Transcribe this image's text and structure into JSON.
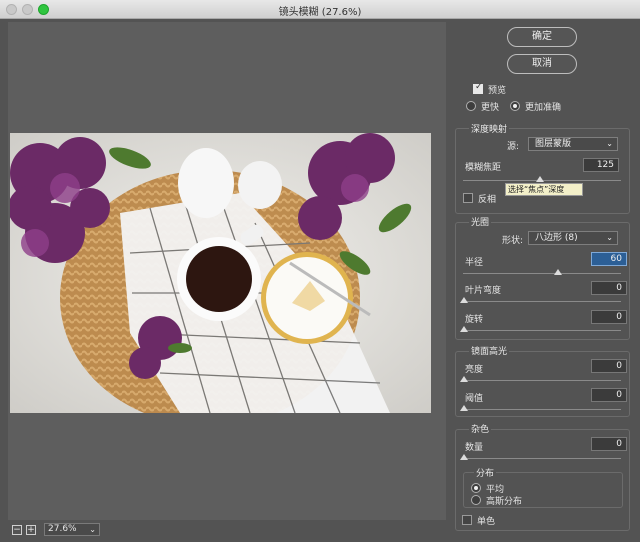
{
  "window": {
    "title": "镜头模糊 (27.6%)"
  },
  "buttons": {
    "ok": "确定",
    "cancel": "取消"
  },
  "preview": {
    "checkbox_label": "预览",
    "radio_faster": "更快",
    "radio_accurate": "更加准确"
  },
  "depth_map": {
    "title": "深度映射",
    "source_label": "源:",
    "source_value": "图层蒙版",
    "blur_focal_label": "模糊焦距",
    "blur_focal_value": "125",
    "blur_focal_level": 125,
    "invert_label": "反相",
    "tooltip": "选择“焦点”深度"
  },
  "iris": {
    "title": "光圈",
    "shape_label": "形状:",
    "shape_value": "八边形 (8)",
    "radius_label": "半径",
    "radius_value": "60",
    "radius_level": 60,
    "curvature_label": "叶片弯度",
    "curvature_value": "0",
    "rotation_label": "旋转",
    "rotation_value": "0"
  },
  "specular": {
    "title": "镜面高光",
    "brightness_label": "亮度",
    "brightness_value": "0",
    "threshold_label": "阈值",
    "threshold_value": "0"
  },
  "noise": {
    "title": "杂色",
    "amount_label": "数量",
    "amount_value": "0",
    "distribution_title": "分布",
    "uniform_label": "平均",
    "gaussian_label": "高斯分布",
    "mono_label": "单色"
  },
  "zoom": {
    "minus": "−",
    "plus": "+",
    "value": "27.6%"
  },
  "icons": {
    "dropdown": "chevron-down-icon"
  }
}
